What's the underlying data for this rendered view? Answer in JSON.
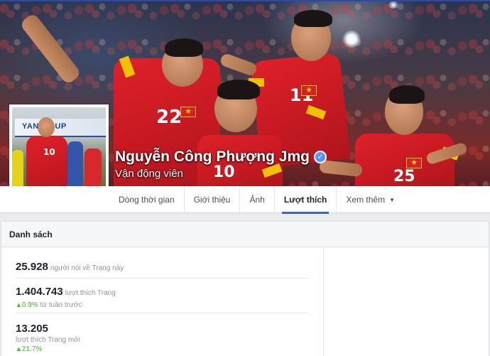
{
  "cover": {
    "player_numbers": [
      "22",
      "10",
      "11",
      "25"
    ],
    "profile_banner_text": "YAN... CUP",
    "profile_jersey_number": "10"
  },
  "page": {
    "name": "Nguyễn Công Phượng Jmg",
    "category": "Vận động viên",
    "verified_icon": "verified-check-icon"
  },
  "tabs": [
    {
      "label": "Dòng thời gian",
      "active": false
    },
    {
      "label": "Giới thiệu",
      "active": false
    },
    {
      "label": "Ảnh",
      "active": false
    },
    {
      "label": "Lượt thích",
      "active": true
    },
    {
      "label": "Xem thêm",
      "active": false,
      "icon": "caret-down-icon"
    }
  ],
  "panel": {
    "title": "Danh sách",
    "stats": [
      {
        "value": "25.928",
        "description": "người nói về Trang này"
      },
      {
        "value": "1.404.743",
        "description": "lượt thích Trang",
        "change": "0.9%",
        "change_text": "từ tuần trước"
      },
      {
        "value": "13.205",
        "description": "lượt thích Trang mới",
        "change": "21.7%"
      }
    ]
  },
  "colors": {
    "accent": "#4267b2",
    "verified": "#5890ff",
    "positive": "#42b72a",
    "jersey_red": "#e0202a"
  }
}
